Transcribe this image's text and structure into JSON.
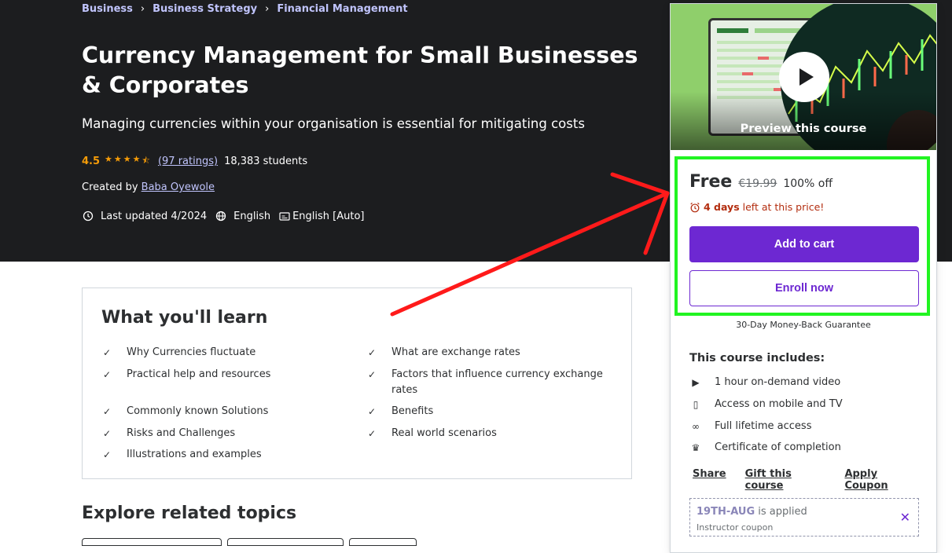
{
  "breadcrumb": [
    "Business",
    "Business Strategy",
    "Financial Management"
  ],
  "course": {
    "title": "Currency Management for Small Businesses & Corporates",
    "subtitle": "Managing currencies within your organisation is essential for mitigating costs",
    "rating": "4.5",
    "ratings_count": "(97 ratings)",
    "students": "18,383 students",
    "created_by_label": "Created by",
    "instructor": "Baba Oyewole",
    "last_updated": "Last updated 4/2024",
    "language": "English",
    "captions": "English [Auto]"
  },
  "learn": {
    "title": "What you'll learn",
    "items": [
      "Why Currencies fluctuate",
      "What are exchange rates",
      "Practical help and resources",
      "Factors that influence currency exchange rates",
      "Commonly known Solutions",
      "Benefits",
      "Risks and Challenges",
      "Real world scenarios",
      "Illustrations and examples"
    ]
  },
  "explore": {
    "title": "Explore related topics"
  },
  "sidebar": {
    "preview_caption": "Preview this course",
    "price": "Free",
    "original_price": "€19.99",
    "discount": "100% off",
    "countdown_days": "4 days",
    "countdown_text": "left at this price!",
    "add_to_cart": "Add to cart",
    "enroll_now": "Enroll now",
    "guarantee": "30-Day Money-Back Guarantee",
    "includes_title": "This course includes:",
    "includes": [
      {
        "icon": "video-icon",
        "glyph": "▶",
        "text": "1 hour on-demand video"
      },
      {
        "icon": "mobile-icon",
        "glyph": "▯",
        "text": "Access on mobile and TV"
      },
      {
        "icon": "infinity-icon",
        "glyph": "∞",
        "text": "Full lifetime access"
      },
      {
        "icon": "trophy-icon",
        "glyph": "♛",
        "text": "Certificate of completion"
      }
    ],
    "links": [
      "Share",
      "Gift this course",
      "Apply Coupon"
    ],
    "coupon_code": "19TH-AUG",
    "coupon_applied": "is applied",
    "coupon_type": "Instructor coupon"
  },
  "colors": {
    "hero_bg": "#1c1d1f",
    "link": "#c0c4fc",
    "rating": "#f69c08",
    "primary": "#6d28d2",
    "alert": "#b32d0f",
    "highlight": "#21f421",
    "arrow": "#ff1a1a"
  }
}
